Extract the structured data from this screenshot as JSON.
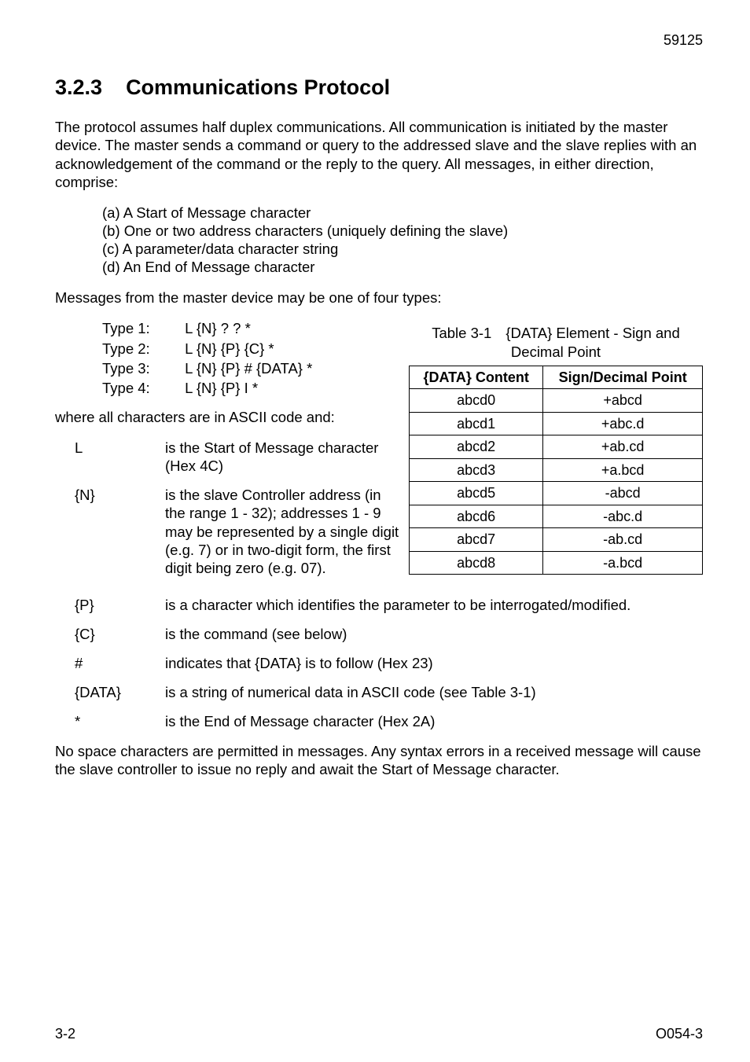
{
  "header": {
    "page_num": "59125"
  },
  "section": {
    "number": "3.2.3",
    "title": "Communications Protocol"
  },
  "para1": "The protocol assumes half duplex communications. All communication is initiated by the master device. The master sends a command or query to the addressed slave and the slave replies with an acknowledgement of the command or the reply to the query. All messages, in either direction, comprise:",
  "msg_parts": {
    "a": "(a) A Start of Message character",
    "b": "(b) One or two address characters (uniquely defining the slave)",
    "c": "(c) A parameter/data character string",
    "d": "(d) An End of Message character"
  },
  "para2": "Messages from the master device may be one of four types:",
  "types": {
    "t1_label": "Type 1:",
    "t1_val": "L {N} ? ? *",
    "t2_label": "Type 2:",
    "t2_val": "L {N} {P} {C} *",
    "t3_label": "Type 3:",
    "t3_val": "L {N} {P} # {DATA} *",
    "t4_label": "Type 4:",
    "t4_val": "L {N} {P} I *"
  },
  "para3": "where all characters are in ASCII code and:",
  "defs": {
    "L": {
      "term": "L",
      "text": "is the Start of Message character (Hex 4C)"
    },
    "N": {
      "term": "{N}",
      "text": "is the slave Controller address (in the range 1 - 32); addresses 1 - 9 may be represented by a single digit (e.g. 7) or in two-digit form, the first digit being zero (e.g. 07)."
    },
    "P": {
      "term": "{P}",
      "text": "is a character which identifies the parameter to be interrogated/modified."
    },
    "C": {
      "term": "{C}",
      "text": "is the command (see below)"
    },
    "hash": {
      "term": "#",
      "text": "indicates that {DATA} is to follow (Hex 23)"
    },
    "DATA": {
      "term": "{DATA}",
      "text": "is a string of numerical data in ASCII code (see Table 3-1)"
    },
    "star": {
      "term": "*",
      "text": "is the End of Message character (Hex 2A)"
    }
  },
  "para4": "No space characters are permitted in messages. Any syntax errors in a received message will cause the slave controller to issue no reply and await the Start of Message character.",
  "table": {
    "label": "Table 3-1",
    "title": "{DATA} Element - Sign and Decimal Point",
    "head_col1": "{DATA} Content",
    "head_col2": "Sign/Decimal Point",
    "rows": [
      {
        "c1": "abcd0",
        "c2": "+abcd"
      },
      {
        "c1": "abcd1",
        "c2": "+abc.d"
      },
      {
        "c1": "abcd2",
        "c2": "+ab.cd"
      },
      {
        "c1": "abcd3",
        "c2": "+a.bcd"
      },
      {
        "c1": "abcd5",
        "c2": "-abcd"
      },
      {
        "c1": "abcd6",
        "c2": "-abc.d"
      },
      {
        "c1": "abcd7",
        "c2": "-ab.cd"
      },
      {
        "c1": "abcd8",
        "c2": "-a.bcd"
      }
    ]
  },
  "chart_data": {
    "type": "table",
    "title": "{DATA} Element - Sign and Decimal Point",
    "columns": [
      "{DATA} Content",
      "Sign/Decimal Point"
    ],
    "rows": [
      [
        "abcd0",
        "+abcd"
      ],
      [
        "abcd1",
        "+abc.d"
      ],
      [
        "abcd2",
        "+ab.cd"
      ],
      [
        "abcd3",
        "+a.bcd"
      ],
      [
        "abcd5",
        "-abcd"
      ],
      [
        "abcd6",
        "-abc.d"
      ],
      [
        "abcd7",
        "-ab.cd"
      ],
      [
        "abcd8",
        "-a.bcd"
      ]
    ]
  },
  "footer": {
    "left": "3-2",
    "right": "O054-3"
  }
}
